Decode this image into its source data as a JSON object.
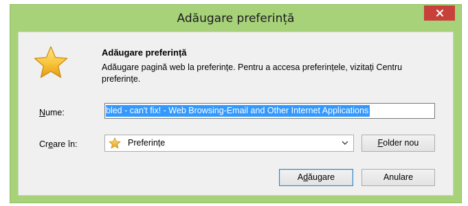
{
  "window": {
    "title": "Adăugare preferință"
  },
  "dialog": {
    "heading": "Adăugare preferință",
    "description": "Adăugare pagină web la preferințe. Pentru a accesa preferințele, vizitați Centru preferințe."
  },
  "form": {
    "name_label_accel": "N",
    "name_label_rest": "ume:",
    "name_value": "bled - can't fix! - Web Browsing-Email and Other Internet Applications",
    "create_label_pre": "Cr",
    "create_label_accel": "e",
    "create_label_post": "are în:",
    "create_selected": "Preferințe"
  },
  "buttons": {
    "new_folder_accel": "F",
    "new_folder_rest": "older nou",
    "add_pre": "A",
    "add_accel": "d",
    "add_post": "ăugare",
    "cancel": "Anulare"
  },
  "icons": {
    "close": "close-icon",
    "favorite_star": "star-icon",
    "dropdown": "chevron-down-icon"
  },
  "colors": {
    "frame": "#a7d27a",
    "close_button": "#c7403a",
    "selection": "#3399ff"
  }
}
